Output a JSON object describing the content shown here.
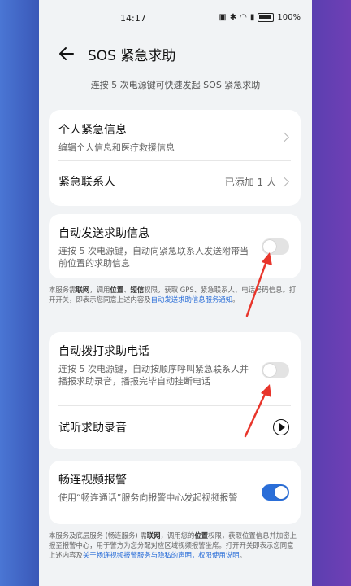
{
  "status": {
    "time": "14:17",
    "battery": "100%"
  },
  "header": {
    "title": "SOS 紧急求助"
  },
  "subtitle": "连按 5 次电源键可快速发起 SOS 紧急求助",
  "card_info": {
    "personal": {
      "label": "个人紧急信息",
      "desc": "编辑个人信息和医疗救援信息"
    },
    "contacts": {
      "label": "紧急联系人",
      "value": "已添加 1 人"
    }
  },
  "card_msg": {
    "label": "自动发送求助信息",
    "desc": "连按 5 次电源键，自动向紧急联系人发送附带当前位置的求助信息",
    "enabled": false
  },
  "note_msg": {
    "p1": "本服务需",
    "b1": "联网",
    "p2": "，调用",
    "b2": "位置",
    "p3": "、",
    "b3": "短信",
    "p4": "权限，获取 GPS、紧急联系人、电话号码信息。打开开关，即表示您同意上述内容及",
    "link": "自动发送求助信息服务通知",
    "p5": "。"
  },
  "card_call": {
    "label": "自动拨打求助电话",
    "desc": "连按 5 次电源键，自动按顺序呼叫紧急联系人并播报求助录音，播报完毕自动挂断电话",
    "enabled": false,
    "listen": {
      "label": "试听求助录音"
    }
  },
  "card_video": {
    "label": "畅连视频报警",
    "desc": "使用“畅连通话”服务向报警中心发起视频报警",
    "enabled": true
  },
  "note_video": {
    "p1": "本服务及底层服务 (畅连服务) 需",
    "b1": "联网",
    "p2": "，调用您的",
    "b2": "位置",
    "p3": "权限，获取位置信息并加密上报至报警中心，用于警方为您分配对应区域视频报警坐席。打开开关即表示您同意上述内容及",
    "link": "关于畅连视频报警服务与隐私的声明，权限使用说明",
    "p4": "。"
  },
  "colors": {
    "accent": "#2a6ed8",
    "arrow": "#e8352b"
  }
}
